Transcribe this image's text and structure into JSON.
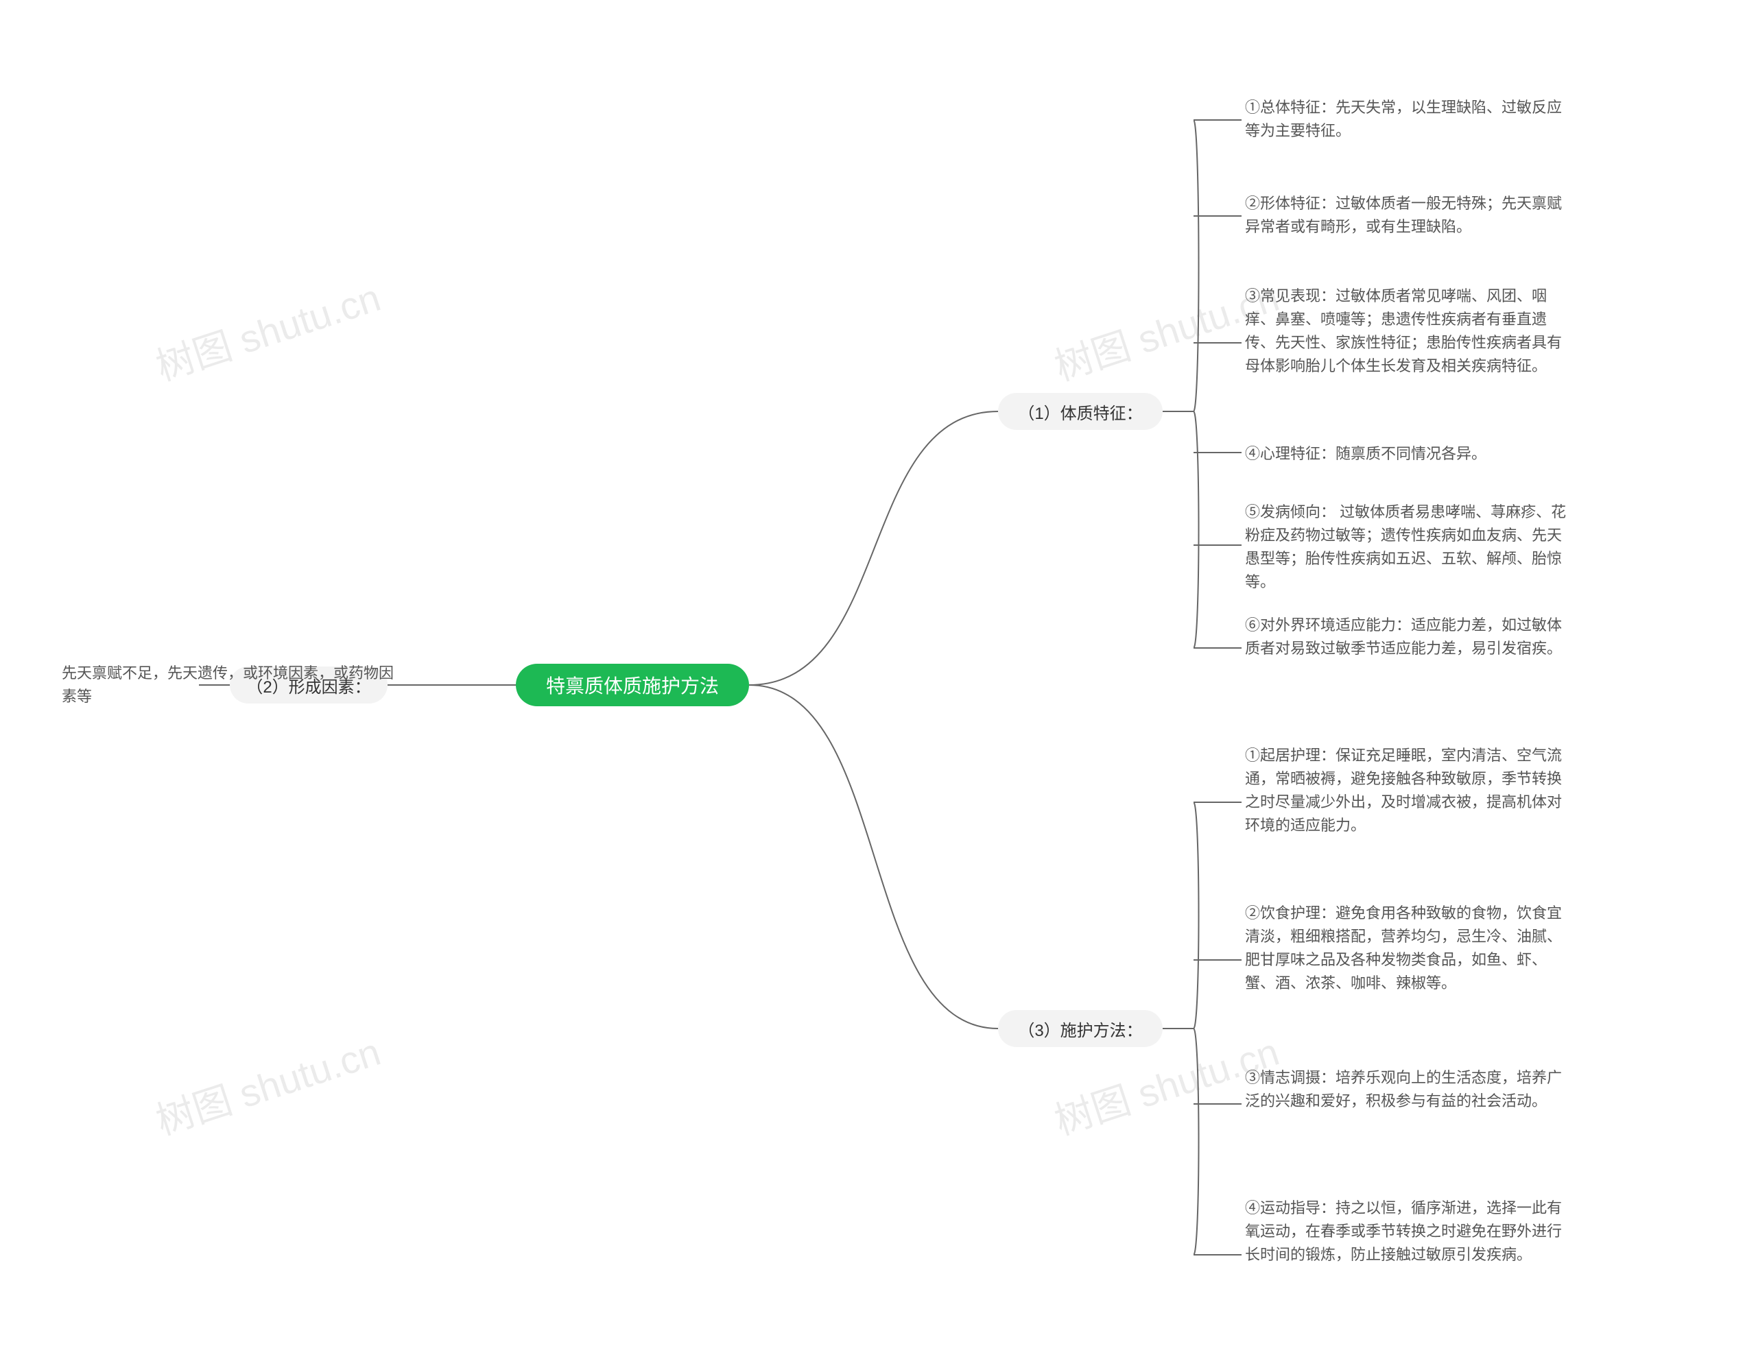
{
  "root": {
    "label": "特禀质体质施护方法"
  },
  "branches": {
    "b1": {
      "label": "（1）体质特征："
    },
    "b2": {
      "label": "（2）形成因素："
    },
    "b3": {
      "label": "（3）施护方法："
    }
  },
  "leaves": {
    "b1_1": "①总体特征：先天失常，以生理缺陷、过敏反应等为主要特征。",
    "b1_2": "②形体特征：过敏体质者一般无特殊；先天禀赋异常者或有畸形，或有生理缺陷。",
    "b1_3": "③常见表现：过敏体质者常见哮喘、风团、咽痒、鼻塞、喷嚏等；患遗传性疾病者有垂直遗传、先天性、家族性特征；患胎传性疾病者具有母体影响胎儿个体生长发育及相关疾病特征。",
    "b1_4": "④心理特征：随禀质不同情况各异。",
    "b1_5": "⑤发病倾向： 过敏体质者易患哮喘、荨麻疹、花粉症及药物过敏等；遗传性疾病如血友病、先天愚型等；胎传性疾病如五迟、五软、解颅、胎惊等。",
    "b1_6": "⑥对外界环境适应能力：适应能力差，如过敏体质者对易致过敏季节适应能力差，易引发宿疾。",
    "b2_1": "先天禀赋不足，先天遗传，或环境因素，或药物因素等",
    "b3_1": "①起居护理：保证充足睡眠，室内清洁、空气流通，常晒被褥，避免接触各种致敏原，季节转换之时尽量减少外出，及时增减衣被，提高机体对环境的适应能力。",
    "b3_2": "②饮食护理：避免食用各种致敏的食物，饮食宜清淡，粗细粮搭配，营养均匀，忌生冷、油腻、肥甘厚味之品及各种发物类食品，如鱼、虾、蟹、酒、浓茶、咖啡、辣椒等。",
    "b3_3": "③情志调摄：培养乐观向上的生活态度，培养广泛的兴趣和爱好，积极参与有益的社会活动。",
    "b3_4": "④运动指导：持之以恒，循序渐进，选择一此有氧运动，在春季或季节转换之时避免在野外进行长时间的锻炼，防止接触过敏原引发疾病。"
  },
  "watermark": "树图 shutu.cn"
}
